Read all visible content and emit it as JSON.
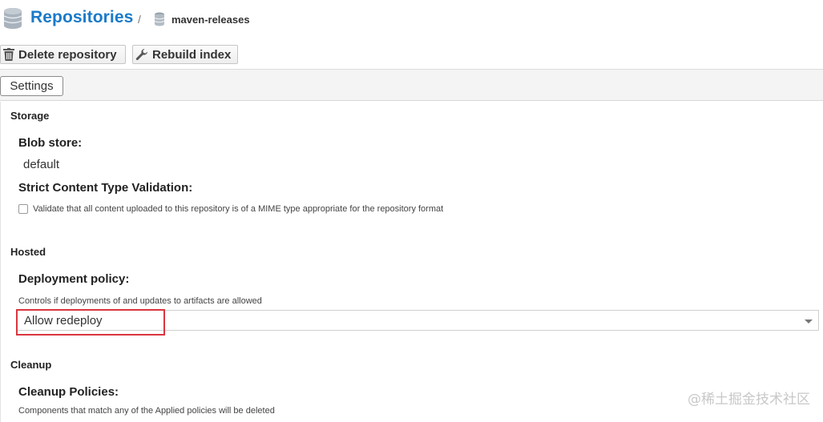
{
  "header": {
    "title": "Repositories",
    "separator": "/",
    "breadcrumb_leaf": "maven-releases"
  },
  "toolbar": {
    "delete_label": "Delete repository",
    "rebuild_label": "Rebuild index"
  },
  "tabs": [
    {
      "label": "Settings"
    }
  ],
  "storage": {
    "section_title": "Storage",
    "blob_store_label": "Blob store:",
    "blob_store_value": "default",
    "strict_label": "Strict Content Type Validation:",
    "strict_checkbox_text": "Validate that all content uploaded to this repository is of a MIME type appropriate for the repository format",
    "strict_checked": false
  },
  "hosted": {
    "section_title": "Hosted",
    "deployment_label": "Deployment policy:",
    "deployment_help": "Controls if deployments of and updates to artifacts are allowed",
    "deployment_value": "Allow redeploy"
  },
  "cleanup": {
    "section_title": "Cleanup",
    "policies_label": "Cleanup Policies:",
    "policies_help": "Components that match any of the Applied policies will be deleted"
  },
  "watermark": "@稀土掘金技术社区",
  "colors": {
    "title": "#1a7ac9",
    "highlight": "#d9363e"
  }
}
